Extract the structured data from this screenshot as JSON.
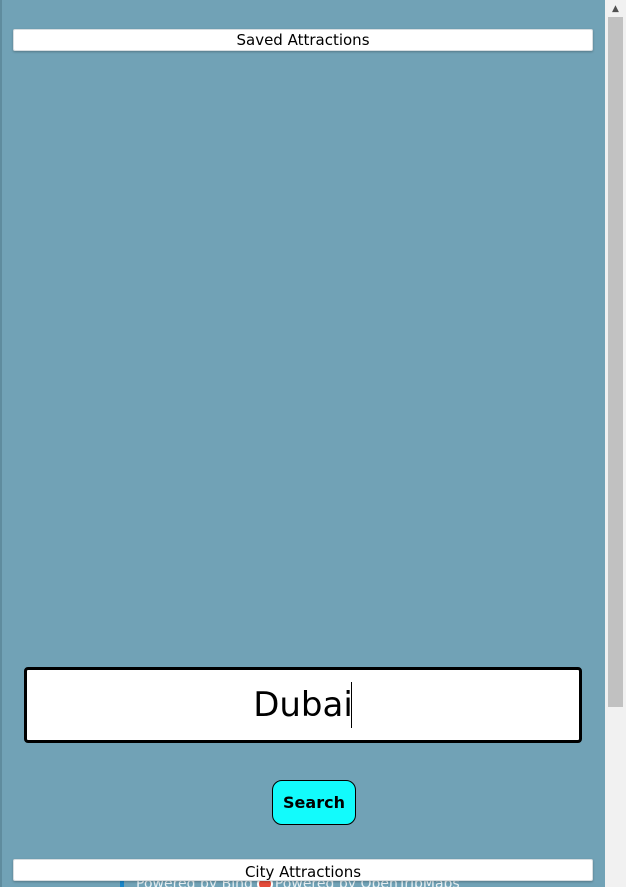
{
  "saved_button": {
    "label": "Saved Attractions"
  },
  "search": {
    "value": "Dubai",
    "button_label": "Search"
  },
  "city_button": {
    "label": "City Attractions"
  },
  "footer": {
    "bing_text": "Powered by Bing",
    "osm_text": "Powered by OpenTripMaps"
  },
  "icons": {
    "bing": "bing-logo-icon",
    "osm": "opentripmap-logo-icon",
    "scroll_up": "scroll-up-arrow-icon"
  },
  "colors": {
    "background": "#71a2b6",
    "search_button": "#12fbfc",
    "bar_button": "#ffffff"
  }
}
